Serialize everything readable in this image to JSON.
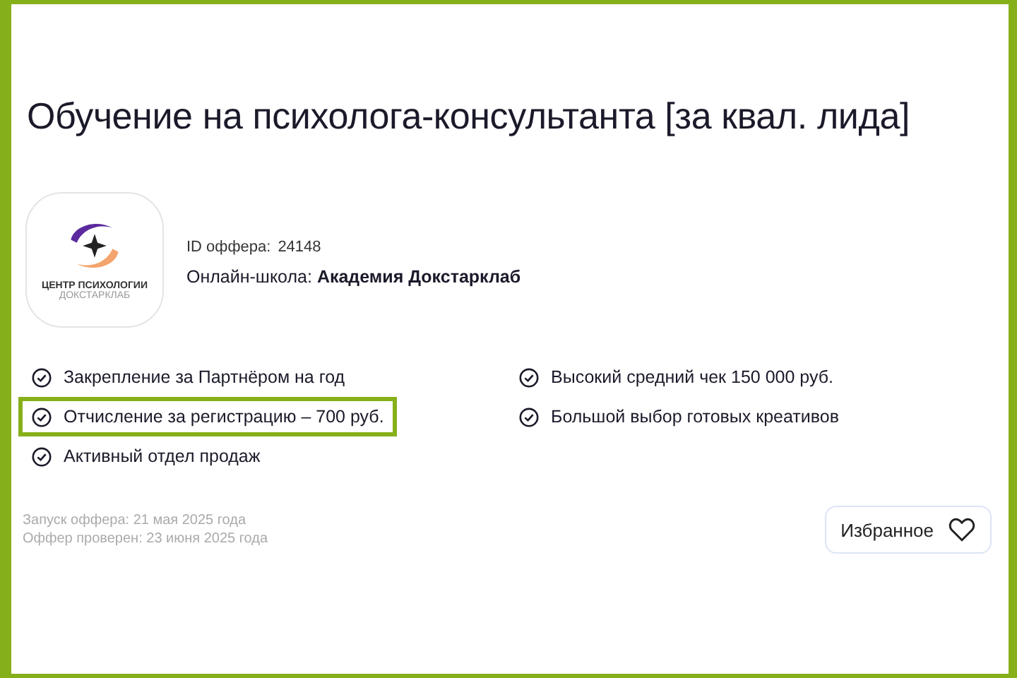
{
  "title": "Обучение на психолога-консультанта [за квал. лида]",
  "logo": {
    "line_1": "ЦЕНТР ПСИХОЛОГИИ",
    "line_2": "ДОКСТАРКЛАБ"
  },
  "offer_id": {
    "label": "ID оффера:",
    "value": "24148"
  },
  "school": "Онлайн-школа: **Академия Докстарклаб**",
  "feature_columns": [
    [
      {
        "text": "Закрепление за Партнёром на год",
        "highlighted": false
      },
      {
        "text": "Отчисление за регистрацию – 700 руб.",
        "highlighted": true
      },
      {
        "text": "Активный отдел продаж",
        "highlighted": false
      }
    ],
    [
      {
        "text": "Высокий средний чек 150 000 руб.",
        "highlighted": false
      },
      {
        "text": "Большой выбор готовых креативов",
        "highlighted": false
      }
    ]
  ],
  "dates": [
    "Запуск оффера: 21 мая 2025 года",
    "Оффер проверен: 23 июня 2025 года"
  ],
  "favorite_button": {
    "label": "Избранное",
    "selected": false
  }
}
